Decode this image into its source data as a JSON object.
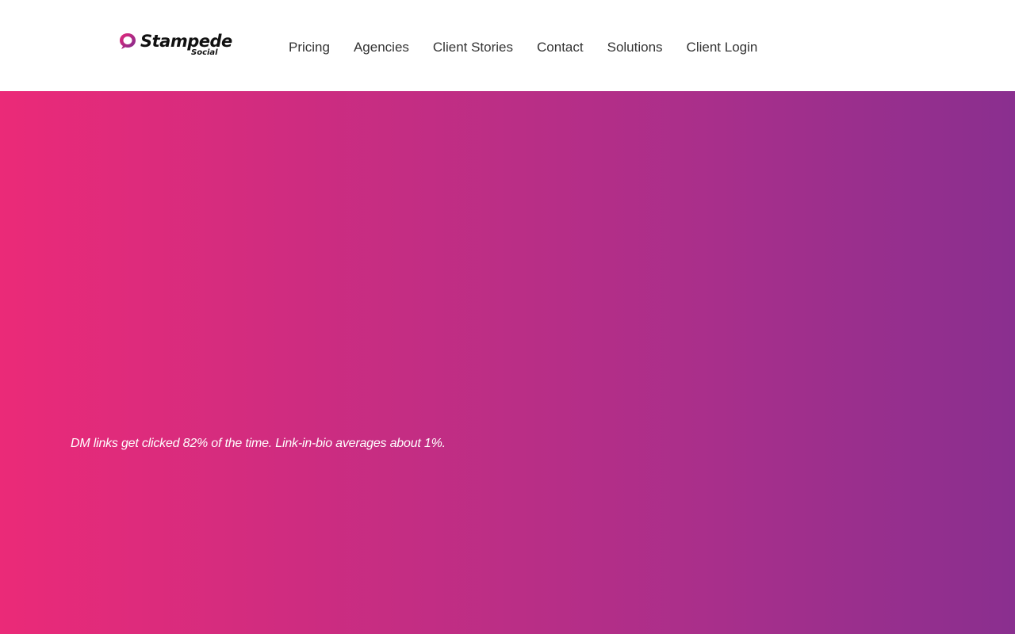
{
  "brand": {
    "name": "Stampede",
    "subname": "Social",
    "mark_color": "#e8287a",
    "mark_color_secondary": "#7a2c8e"
  },
  "nav": {
    "items": [
      {
        "label": "Pricing"
      },
      {
        "label": "Agencies"
      },
      {
        "label": "Client Stories"
      },
      {
        "label": "Contact"
      },
      {
        "label": "Solutions"
      },
      {
        "label": "Client Login"
      }
    ]
  },
  "hero": {
    "tagline": "DM links get clicked 82% of the time. Link-in-bio averages about 1%.",
    "gradient_start": "#eb2a78",
    "gradient_end": "#8a2f8f"
  }
}
